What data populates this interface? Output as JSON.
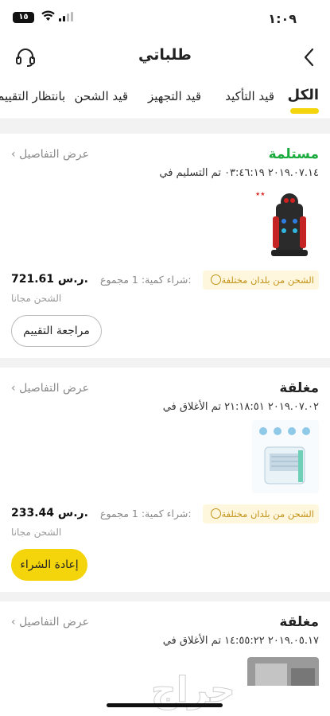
{
  "status_bar": {
    "time": "١:٠٩",
    "battery": "١٥"
  },
  "header": {
    "title": "طلباتي"
  },
  "tabs": [
    {
      "label": "الكل"
    },
    {
      "label": "قيد التأكيد"
    },
    {
      "label": "قيد التجهيز"
    },
    {
      "label": "قيد الشحن"
    },
    {
      "label": "بانتظار التقييم"
    }
  ],
  "orders": [
    {
      "status": "مستلمة",
      "details_link": "عرض التفاصيل",
      "date_text": "٢٠١٩.٠٧.١٤ ٠٣:٤٦:١٩ تم التسليم في",
      "shipping_tag": "الشحن من بلدان مختلفة",
      "qty_text": "شراء كمية: 1 مجموع:",
      "price": "721.61 ر.س.",
      "shipping": "الشحن مجانا",
      "button": "مراجعة التقييم"
    },
    {
      "status": "مغلقة",
      "details_link": "عرض التفاصيل",
      "date_text": "٢٠١٩.٠٧.٠٢ ٢١:١٨:٥١ تم الأغلاق في",
      "shipping_tag": "الشحن من بلدان مختلفة",
      "qty_text": "شراء كمية: 1 مجموع:",
      "price": "233.44 ر.س.",
      "shipping": "الشحن مجانا",
      "button": "إعادة الشراء"
    },
    {
      "status": "مغلقة",
      "details_link": "عرض التفاصيل",
      "date_text": "٢٠١٩.٠٥.١٧ ١٤:٥٥:٢٢ تم الأغلاق في"
    }
  ],
  "colors": {
    "accent": "#f4d40b",
    "received": "#1aab3d",
    "tag_bg": "#fff7dd",
    "tag_text": "#c2931a"
  },
  "watermark": "حراج"
}
